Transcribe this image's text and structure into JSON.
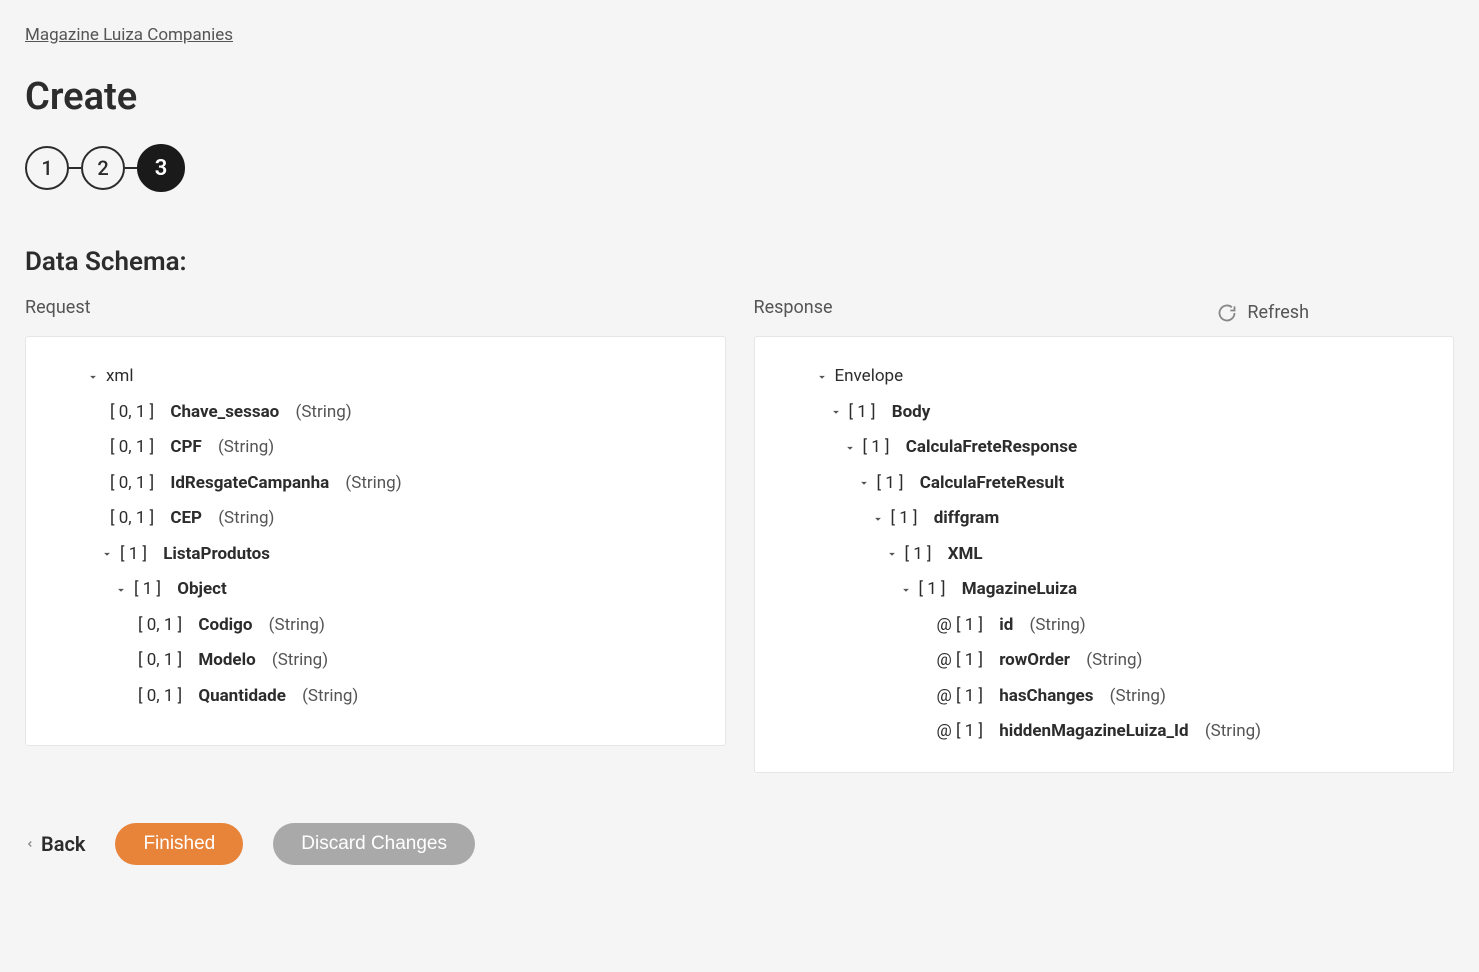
{
  "breadcrumb": "Magazine Luiza Companies",
  "page_title": "Create",
  "stepper": {
    "step1": "1",
    "step2": "2",
    "step3": "3"
  },
  "section_title": "Data Schema:",
  "refresh_label": "Refresh",
  "request_label": "Request",
  "response_label": "Response",
  "request_tree": {
    "root": "xml",
    "chave_sessao_card": "[ 0, 1 ]",
    "chave_sessao_name": "Chave_sessao",
    "chave_sessao_type": "(String)",
    "cpf_card": "[ 0, 1 ]",
    "cpf_name": "CPF",
    "cpf_type": "(String)",
    "idresgate_card": "[ 0, 1 ]",
    "idresgate_name": "IdResgateCampanha",
    "idresgate_type": "(String)",
    "cep_card": "[ 0, 1 ]",
    "cep_name": "CEP",
    "cep_type": "(String)",
    "lista_card": "[ 1 ]",
    "lista_name": "ListaProdutos",
    "object_card": "[ 1 ]",
    "object_name": "Object",
    "codigo_card": "[ 0, 1 ]",
    "codigo_name": "Codigo",
    "codigo_type": "(String)",
    "modelo_card": "[ 0, 1 ]",
    "modelo_name": "Modelo",
    "modelo_type": "(String)",
    "quant_card": "[ 0, 1 ]",
    "quant_name": "Quantidade",
    "quant_type": "(String)"
  },
  "response_tree": {
    "root": "Envelope",
    "body_card": "[ 1 ]",
    "body_name": "Body",
    "cfr_card": "[ 1 ]",
    "cfr_name": "CalculaFreteResponse",
    "cfres_card": "[ 1 ]",
    "cfres_name": "CalculaFreteResult",
    "diff_card": "[ 1 ]",
    "diff_name": "diffgram",
    "xml_card": "[ 1 ]",
    "xml_name": "XML",
    "ml_card": "[ 1 ]",
    "ml_name": "MagazineLuiza",
    "id_card": "@ [ 1 ]",
    "id_name": "id",
    "id_type": "(String)",
    "row_card": "@ [ 1 ]",
    "row_name": "rowOrder",
    "row_type": "(String)",
    "has_card": "@ [ 1 ]",
    "has_name": "hasChanges",
    "has_type": "(String)",
    "hidden_card": "@ [ 1 ]",
    "hidden_name": "hiddenMagazineLuiza_Id",
    "hidden_type": "(String)"
  },
  "footer": {
    "back": "Back",
    "finished": "Finished",
    "discard": "Discard Changes"
  }
}
